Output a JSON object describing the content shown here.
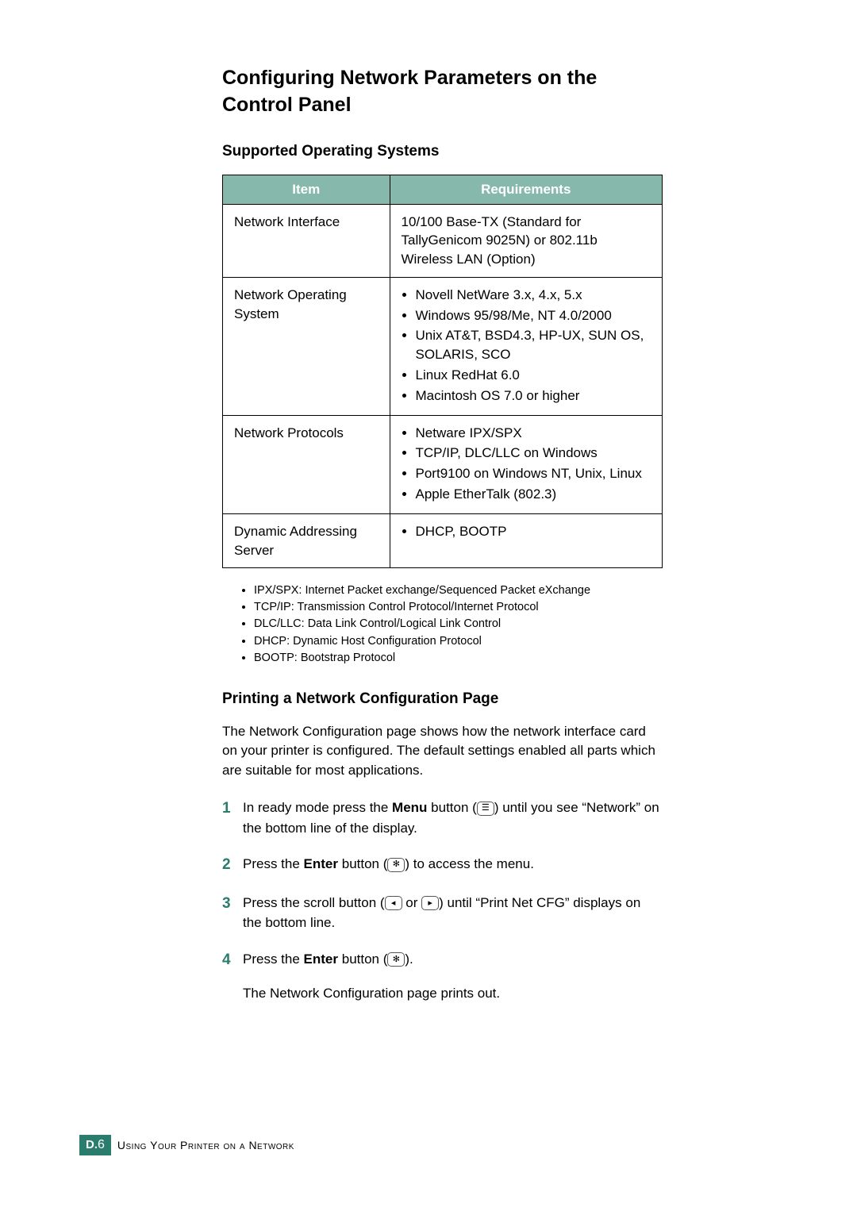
{
  "title": "Configuring Network Parameters on the Control Panel",
  "section1_title": "Supported Operating Systems",
  "table": {
    "head_item": "Item",
    "head_req": "Requirements",
    "rows": [
      {
        "item": "Network Interface",
        "req_text": "10/100 Base-TX (Standard for TallyGenicom 9025N) or 802.11b Wireless LAN (Option)"
      },
      {
        "item": "Network Operating System",
        "req_list": [
          "Novell NetWare 3.x, 4.x, 5.x",
          "Windows 95/98/Me, NT 4.0/2000",
          "Unix AT&T, BSD4.3, HP-UX, SUN OS, SOLARIS, SCO",
          "Linux RedHat 6.0",
          "Macintosh OS 7.0 or higher"
        ]
      },
      {
        "item": "Network Protocols",
        "req_list": [
          "Netware IPX/SPX",
          "TCP/IP, DLC/LLC on Windows",
          "Port9100 on Windows NT, Unix, Linux",
          "Apple EtherTalk (802.3)"
        ]
      },
      {
        "item": "Dynamic Addressing Server",
        "req_list": [
          "DHCP, BOOTP"
        ]
      }
    ]
  },
  "defs": [
    "IPX/SPX: Internet Packet exchange/Sequenced Packet eXchange",
    "TCP/IP: Transmission Control Protocol/Internet Protocol",
    "DLC/LLC: Data Link Control/Logical Link Control",
    "DHCP: Dynamic Host Configuration Protocol",
    "BOOTP: Bootstrap Protocol"
  ],
  "section2_title": "Printing a Network Configuration Page",
  "section2_para": "The Network Configuration page shows how the network interface card on your printer is configured. The default settings enabled all parts which are suitable for most applications.",
  "steps": {
    "s1a": "In ready mode press the ",
    "s1b": "Menu",
    "s1c": " button (",
    "s1d": ") until you see “Network” on the bottom line of the display.",
    "s2a": "Press the ",
    "s2b": "Enter",
    "s2c": " button (",
    "s2d": ") to access the menu.",
    "s3a": "Press the scroll button (",
    "s3b": " or ",
    "s3c": ") until “Print Net CFG” displays on the bottom line.",
    "s4a": "Press the ",
    "s4b": "Enter",
    "s4c": " button (",
    "s4d": ").",
    "s4extra": "The Network Configuration page prints out."
  },
  "icons": {
    "menu": "☰",
    "enter": "✻",
    "left": "◂",
    "right": "▸"
  },
  "footer": {
    "section": "D.",
    "page": "6",
    "text": "Using Your Printer on a Network"
  }
}
